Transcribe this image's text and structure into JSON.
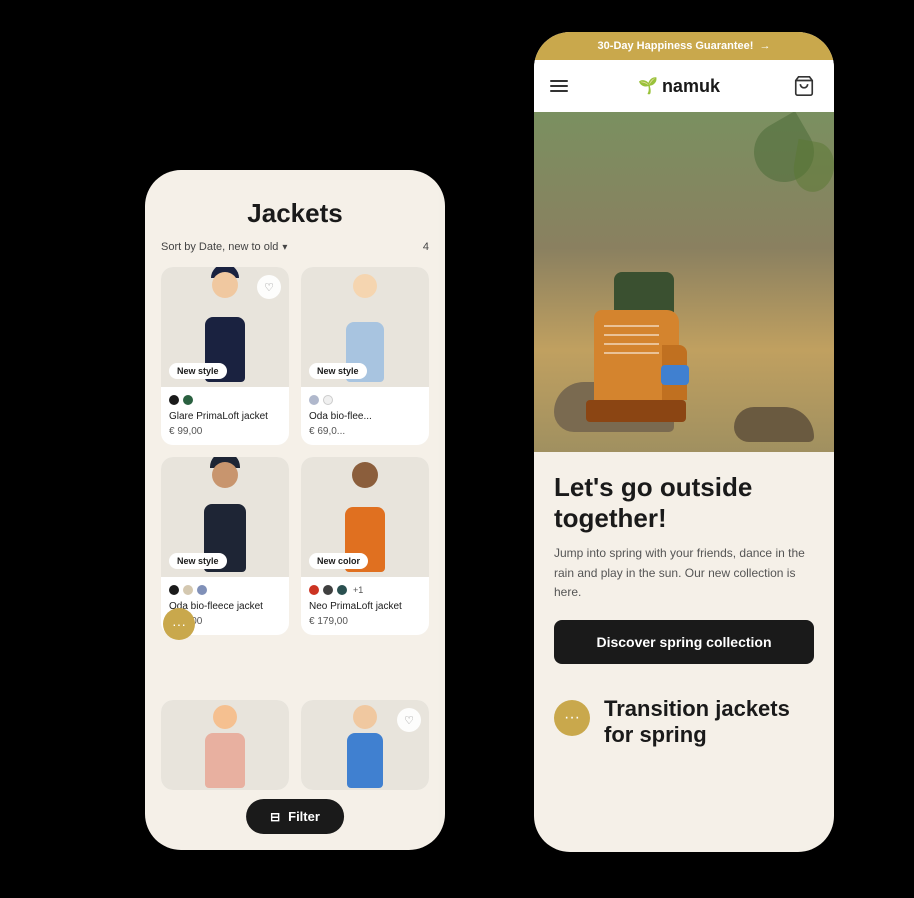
{
  "scene": {
    "bg_color": "#000"
  },
  "phone_back": {
    "title": "Jackets",
    "sort_label": "Sort by Date, new to old",
    "sort_count": "4",
    "products": [
      {
        "id": "p1",
        "name": "Glare PrimaLoft jacket",
        "price": "€ 99,00",
        "badge": "New style",
        "colors": [
          "#1a1a1a",
          "#2a6040"
        ],
        "has_wishlist": true
      },
      {
        "id": "p2",
        "name": "Oda bio-flee...",
        "price": "€ 69,0...",
        "badge": "New style",
        "colors": [
          "#b0b8cc",
          "#f0f0f0"
        ],
        "has_wishlist": false
      },
      {
        "id": "p3",
        "name": "Oda bio-fleece jacket",
        "price": "€ 69,00",
        "badge": "New style",
        "colors": [
          "#1a1a1a",
          "#d4c8b0",
          "#8090b8"
        ],
        "has_wishlist": false
      },
      {
        "id": "p4",
        "name": "Neo PrimaLoft jacket",
        "price": "€ 179,00",
        "badge": "New color",
        "colors": [
          "#cc3322",
          "#404040",
          "#2a5050",
          "+1"
        ],
        "has_wishlist": false
      }
    ],
    "filter_label": "Filter",
    "chat_icon": "···"
  },
  "phone_front": {
    "announce_bar": "30-Day Happiness Guarantee!",
    "announce_arrow": "→",
    "logo": "namuk",
    "logo_icon": "🌱",
    "hero_headline": "Let's go outside together!",
    "hero_subtext": "Jump into spring with your friends, dance in the rain and play in the sun. Our new collection is here.",
    "cta_label": "Discover spring collection",
    "teaser_title": "Transition jackets for spring",
    "chat_icon": "···"
  }
}
